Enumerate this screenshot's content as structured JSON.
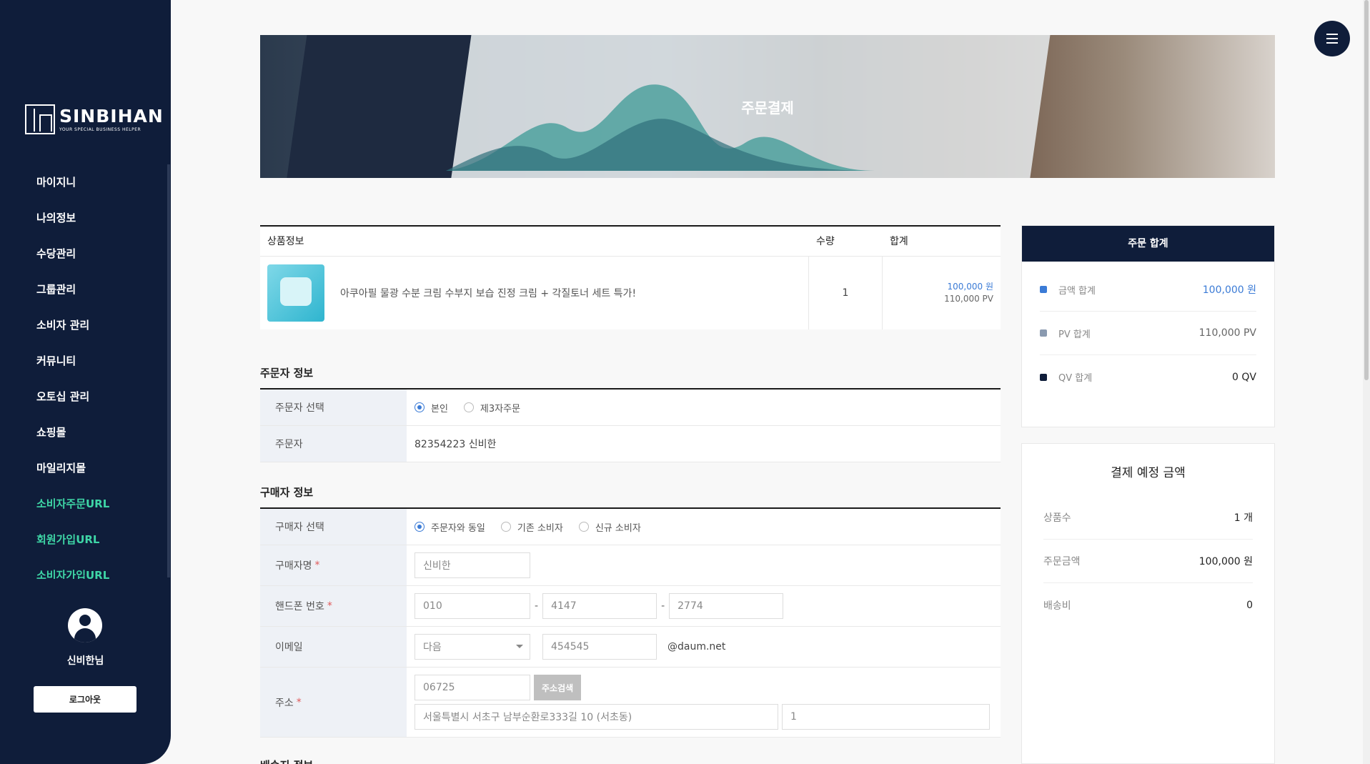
{
  "brand": {
    "name": "SINBIHAN",
    "tagline": "YOUR SPECIAL BUSINESS HELPER"
  },
  "nav": [
    {
      "label": "마이지니",
      "active": false
    },
    {
      "label": "나의정보",
      "active": false
    },
    {
      "label": "수당관리",
      "active": false
    },
    {
      "label": "그룹관리",
      "active": false
    },
    {
      "label": "소비자 관리",
      "active": false
    },
    {
      "label": "커뮤니티",
      "active": false
    },
    {
      "label": "오토십 관리",
      "active": false
    },
    {
      "label": "쇼핑몰",
      "active": false
    },
    {
      "label": "마일리지몰",
      "active": false
    },
    {
      "label": "소비자주문URL",
      "active": true
    },
    {
      "label": "회원가입URL",
      "active": true
    },
    {
      "label": "소비자가입URL",
      "active": true
    }
  ],
  "profile": {
    "name": "신비한님",
    "logout_label": "로그아웃"
  },
  "banner": {
    "title": "주문결제"
  },
  "product_table": {
    "headers": {
      "info": "상품정보",
      "qty": "수량",
      "total": "합계"
    },
    "items": [
      {
        "name": "아쿠아필 물광 수분 크림 수부지 보습 진정 크림 + 각질토너 세트 특가!",
        "qty": "1",
        "price": "100,000 원",
        "pv": "110,000 PV"
      }
    ]
  },
  "orderer": {
    "section_title": "주문자 정보",
    "select_label": "주문자 선택",
    "options": [
      {
        "label": "본인",
        "checked": true
      },
      {
        "label": "제3자주문",
        "checked": false
      }
    ],
    "name_label": "주문자",
    "name_value": "82354223 신비한"
  },
  "buyer": {
    "section_title": "구매자 정보",
    "select_label": "구매자 선택",
    "options": [
      {
        "label": "주문자와 동일",
        "checked": true
      },
      {
        "label": "기존 소비자",
        "checked": false
      },
      {
        "label": "신규 소비자",
        "checked": false
      }
    ],
    "name_label": "구매자명",
    "name_value": "신비한",
    "phone_label": "핸드폰 번호",
    "phone": [
      "010",
      "4147",
      "2774"
    ],
    "email_label": "이메일",
    "email_select": "다음",
    "email_id": "454545",
    "email_domain": "@daum.net",
    "address_label": "주소",
    "zip": "06725",
    "search_button": "주소검색",
    "address1": "서울특별시 서초구 남부순환로333길 10 (서초동)",
    "address2": "1"
  },
  "next_section_title": "배송지 정보",
  "order_summary": {
    "title": "주문 합계",
    "rows": [
      {
        "label": "금액 합계",
        "value": "100,000 원",
        "color": "#3b7bd6",
        "value_color": "#3b7bd6"
      },
      {
        "label": "PV 합계",
        "value": "110,000 PV",
        "color": "#8a9ab0",
        "value_color": "#666666"
      },
      {
        "label": "QV 합계",
        "value": "0 QV",
        "color": "#0f1d3a",
        "value_color": "#222222"
      }
    ]
  },
  "payment": {
    "title": "결제 예정 금액",
    "rows": [
      {
        "label": "상품수",
        "value": "1 개"
      },
      {
        "label": "주문금액",
        "value": "100,000 원"
      },
      {
        "label": "배송비",
        "value": "0"
      }
    ]
  }
}
